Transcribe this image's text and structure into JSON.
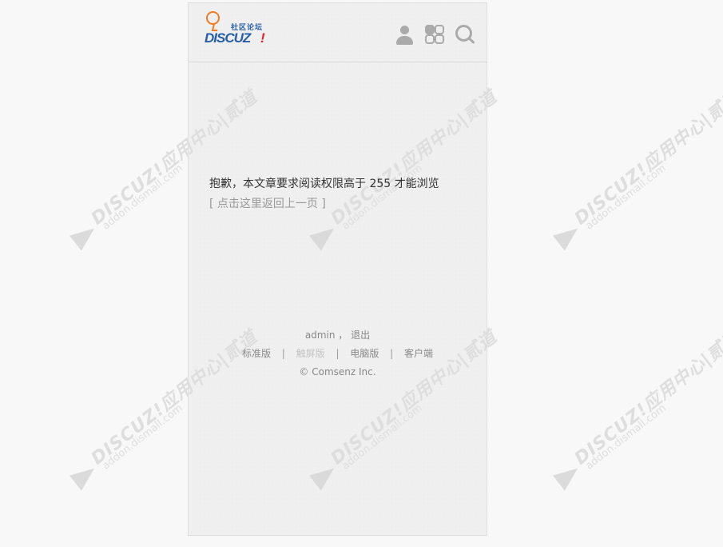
{
  "logo": {
    "cn": "社区论坛",
    "word": "DISCUZ",
    "mark": "!"
  },
  "icons": {
    "user": "user-icon",
    "menu": "grid-icon",
    "search": "search-icon"
  },
  "message": {
    "text": "抱歉，本文章要求阅读权限高于 255 才能浏览",
    "back_link": "[ 点击这里返回上一页 ]"
  },
  "footer": {
    "user": "admin",
    "comma": "，",
    "logout": "退出",
    "links": [
      "标准版",
      "触屏版",
      "电脑版",
      "客户端"
    ],
    "separator": "|",
    "copyright": "© Comsenz Inc."
  },
  "watermark": {
    "main": "DISCUZ!应用中心|贰道",
    "sub": "addon.dismall.com"
  },
  "colors": {
    "logo_blue": "#245ea8",
    "logo_orange": "#ef7b22",
    "logo_red": "#ed1c24",
    "icon_gray": "#aaaaaa",
    "background": "#efefef"
  }
}
